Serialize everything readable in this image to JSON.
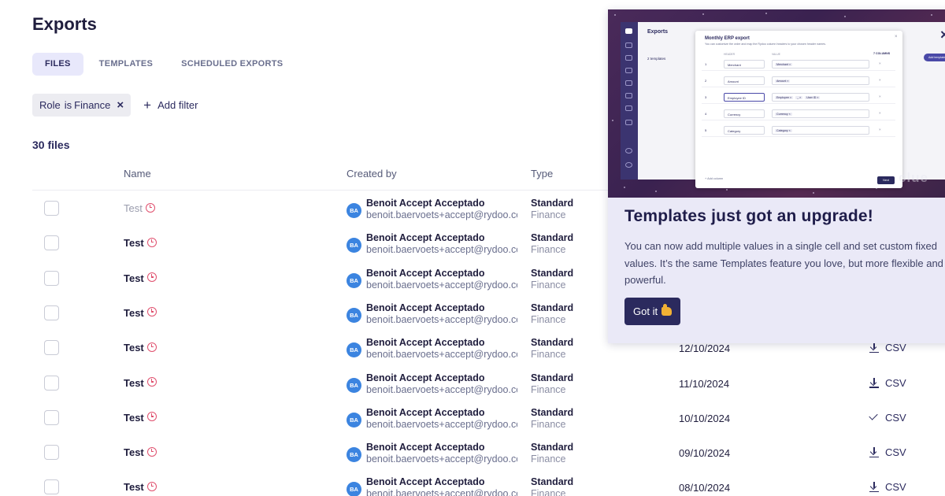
{
  "page": {
    "title": "Exports"
  },
  "tabs": [
    {
      "label": "FILES",
      "active": true
    },
    {
      "label": "TEMPLATES",
      "active": false
    },
    {
      "label": "SCHEDULED EXPORTS",
      "active": false
    }
  ],
  "filters": {
    "chip": {
      "field": "Role",
      "operator": "is",
      "value": "Finance",
      "remove_icon": "close-icon"
    },
    "add_filter_label": "Add filter"
  },
  "file_count": "30 files",
  "columns": {
    "name": "Name",
    "created_by": "Created by",
    "type": "Type"
  },
  "rows": [
    {
      "name": "Test",
      "muted": true,
      "avatar": "BA",
      "creator_name": "Benoit Accept Acceptado",
      "creator_email": "benoit.baervoets+accept@rydoo.com",
      "type": "Standard",
      "subtype": "Finance",
      "date": "",
      "format": "",
      "format_icon": ""
    },
    {
      "name": "Test",
      "muted": false,
      "avatar": "BA",
      "creator_name": "Benoit Accept Acceptado",
      "creator_email": "benoit.baervoets+accept@rydoo.com",
      "type": "Standard",
      "subtype": "Finance",
      "date": "",
      "format": "",
      "format_icon": ""
    },
    {
      "name": "Test",
      "muted": false,
      "avatar": "BA",
      "creator_name": "Benoit Accept Acceptado",
      "creator_email": "benoit.baervoets+accept@rydoo.com",
      "type": "Standard",
      "subtype": "Finance",
      "date": "",
      "format": "",
      "format_icon": ""
    },
    {
      "name": "Test",
      "muted": false,
      "avatar": "BA",
      "creator_name": "Benoit Accept Acceptado",
      "creator_email": "benoit.baervoets+accept@rydoo.com",
      "type": "Standard",
      "subtype": "Finance",
      "date": "",
      "format": "",
      "format_icon": ""
    },
    {
      "name": "Test",
      "muted": false,
      "avatar": "BA",
      "creator_name": "Benoit Accept Acceptado",
      "creator_email": "benoit.baervoets+accept@rydoo.com",
      "type": "Standard",
      "subtype": "Finance",
      "date": "12/10/2024",
      "format": "CSV",
      "format_icon": "download-icon"
    },
    {
      "name": "Test",
      "muted": false,
      "avatar": "BA",
      "creator_name": "Benoit Accept Acceptado",
      "creator_email": "benoit.baervoets+accept@rydoo.com",
      "type": "Standard",
      "subtype": "Finance",
      "date": "11/10/2024",
      "format": "CSV",
      "format_icon": "download-icon"
    },
    {
      "name": "Test",
      "muted": false,
      "avatar": "BA",
      "creator_name": "Benoit Accept Acceptado",
      "creator_email": "benoit.baervoets+accept@rydoo.com",
      "type": "Standard",
      "subtype": "Finance",
      "date": "10/10/2024",
      "format": "CSV",
      "format_icon": "check-icon"
    },
    {
      "name": "Test",
      "muted": false,
      "avatar": "BA",
      "creator_name": "Benoit Accept Acceptado",
      "creator_email": "benoit.baervoets+accept@rydoo.com",
      "type": "Standard",
      "subtype": "Finance",
      "date": "09/10/2024",
      "format": "CSV",
      "format_icon": "download-icon"
    },
    {
      "name": "Test",
      "muted": false,
      "avatar": "BA",
      "creator_name": "Benoit Accept Acceptado",
      "creator_email": "benoit.baervoets+accept@rydoo.com",
      "type": "Standard",
      "subtype": "Finance",
      "date": "08/10/2024",
      "format": "CSV",
      "format_icon": "download-icon"
    }
  ],
  "popover": {
    "title": "Templates just got an upgrade!",
    "body": "You can now add multiple values in a single cell and set custom fixed values. It’s the same Templates feature you love, but more flexible and powerful.",
    "button_label": "Got it",
    "button_icon": "thumbs-up-icon",
    "close_icon": "close-icon",
    "preview": {
      "app_title": "Exports",
      "bg_label": "2 templates",
      "modal_title": "Monthly ERP export",
      "modal_subtitle": "You can customize the order and map the Rydoo column headers to your chosen header names.",
      "columns_label": "7 COLUMNS",
      "head_header": "HEADER",
      "head_value": "VALUE",
      "rows": [
        {
          "n": "1",
          "header": "Merchant",
          "tags": [
            "Merchant ×"
          ]
        },
        {
          "n": "2",
          "header": "Amount",
          "tags": [
            "Amount ×"
          ]
        },
        {
          "n": "3",
          "header": "Employee ID",
          "tags": [
            "Employee ×",
            "_ ×",
            "User ID ×"
          ]
        },
        {
          "n": "4",
          "header": "Currency",
          "tags": [
            "Currency ×"
          ]
        },
        {
          "n": "5",
          "header": "Category",
          "tags": [
            "Category ×"
          ]
        }
      ],
      "add_column": "+ Add column",
      "next": "Next",
      "pill": "Add template",
      "watermark": "clue"
    }
  },
  "colors": {
    "primary": "#2b2a5e",
    "accent": "#4a49a8",
    "avatar": "#3b84e0",
    "popover_bg": "#eae9f7",
    "alarm": "#e0506e"
  }
}
